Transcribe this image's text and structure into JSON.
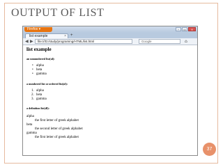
{
  "slide": {
    "title": "OUTPUT OF LIST",
    "page_number": "37"
  },
  "browser": {
    "app_button": "Firefox ▾",
    "tab_title": "list example",
    "tab_close": "×",
    "new_tab": "+",
    "url": "file:///D:/study/programing/HTML/list.html",
    "search_placeholder": "Google",
    "window_buttons": [
      "–",
      "▭",
      "×"
    ],
    "icons": {
      "back": "back-arrow-icon",
      "forward": "forward-arrow-icon",
      "home": "home-icon"
    }
  },
  "page": {
    "title": "list example",
    "unordered_heading": "an unnumbered list(ul):",
    "unordered_items": [
      "alpha",
      "beta",
      "gamma"
    ],
    "ordered_heading": "a numbered list or ordered list(ol):",
    "ordered_items": [
      "alpha",
      "beta",
      "gamma"
    ],
    "ordered_numbers": [
      "1.",
      "2.",
      "3."
    ],
    "definition_heading": "a definition list(dl):",
    "definition_items": [
      {
        "term": "alpha",
        "definition": "the first letter of greek alphabet"
      },
      {
        "term": "beta",
        "definition": "the second letter of greek alphabet"
      },
      {
        "term": "gamma",
        "definition": "the first letter of greek alphabet"
      }
    ]
  }
}
